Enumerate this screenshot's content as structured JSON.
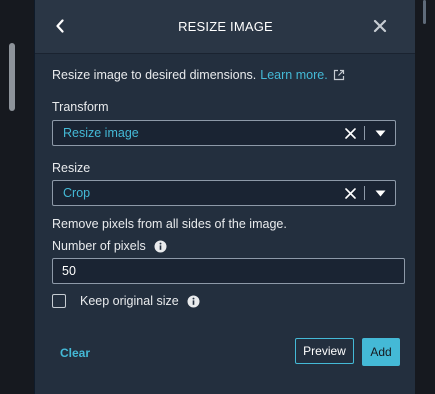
{
  "header": {
    "title": "RESIZE IMAGE",
    "back_icon": "chevron-left-icon",
    "close_icon": "close-icon"
  },
  "description": {
    "text": "Resize image to desired dimensions.",
    "link": "Learn more.",
    "link_icon": "external-link-icon"
  },
  "transform": {
    "label": "Transform",
    "value": "Resize image"
  },
  "resize": {
    "label": "Resize",
    "value": "Crop",
    "helper": "Remove pixels from all sides of the image."
  },
  "pixels": {
    "label": "Number of pixels",
    "value": "50"
  },
  "keep_size": {
    "label": "Keep original size",
    "checked": false
  },
  "footer": {
    "clear": "Clear",
    "preview": "Preview",
    "add": "Add"
  },
  "colors": {
    "accent": "#44b9d6",
    "panel_bg": "#232f3e",
    "header_bg": "#2a3645"
  }
}
